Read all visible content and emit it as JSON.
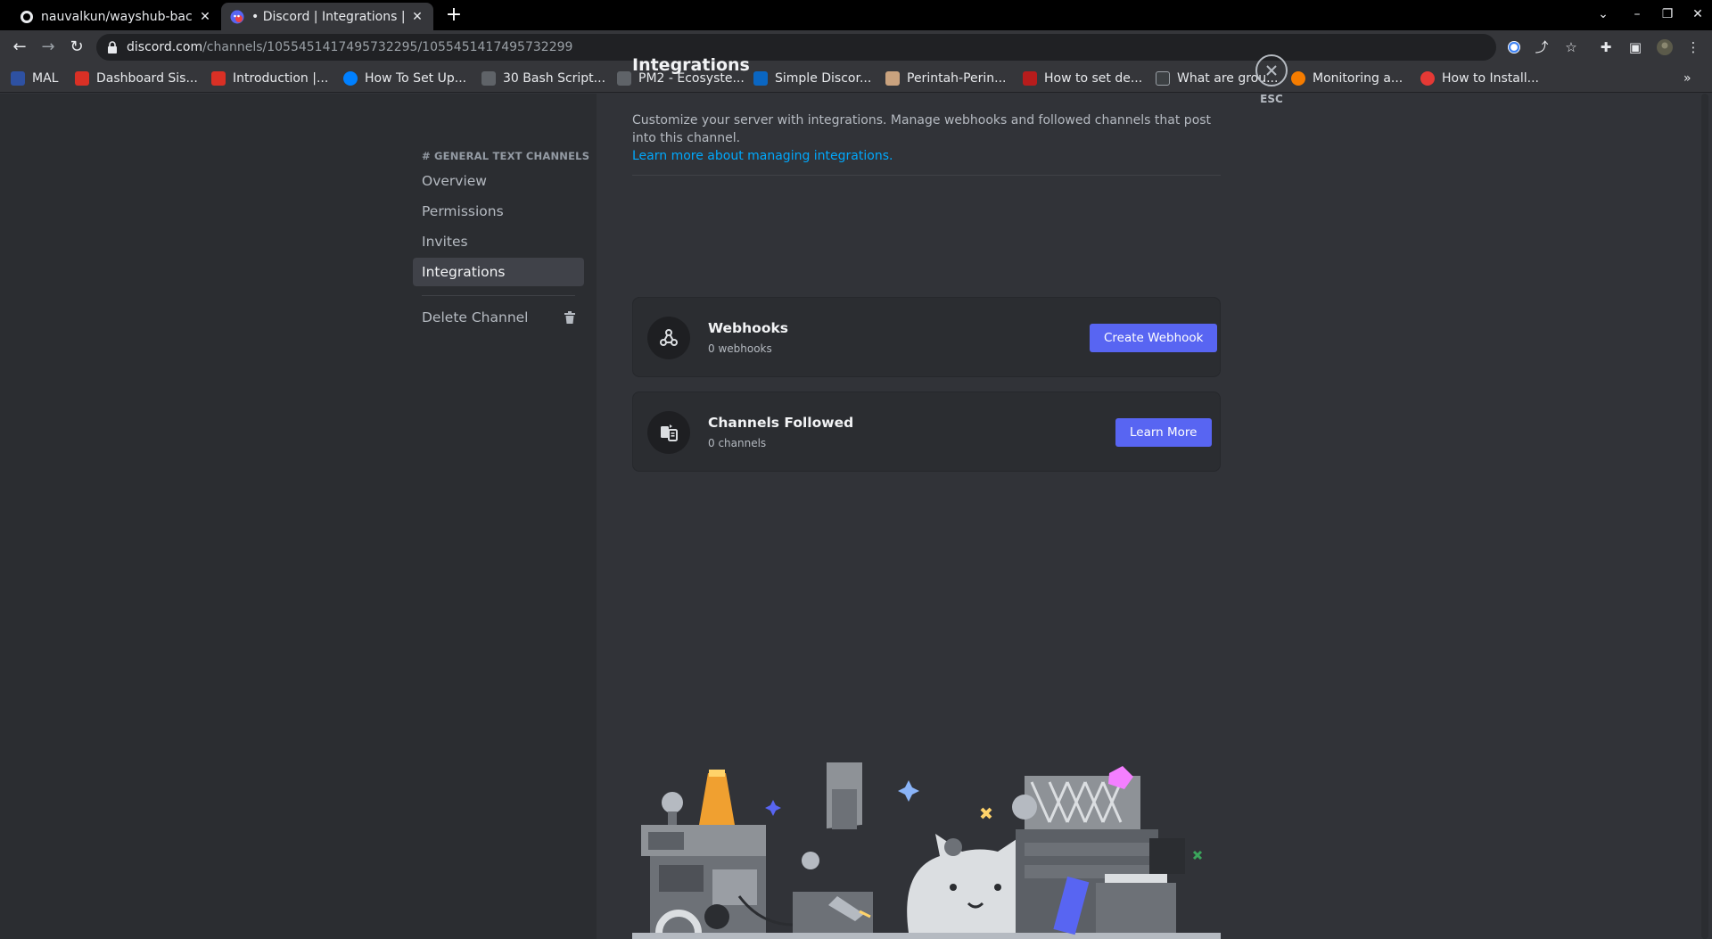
{
  "browser": {
    "tabs": [
      {
        "title": "nauvalkun/wayshub-back",
        "active": false
      },
      {
        "title": "• Discord | Integrations | D",
        "active": true
      }
    ],
    "url_host": "discord.com",
    "url_path": "/channels/1055451417495732295/1055451417495732299",
    "bookmarks": [
      {
        "label": "MAL",
        "color": "#2e51a2"
      },
      {
        "label": "Dashboard Sis...",
        "color": "#d93025"
      },
      {
        "label": "Introduction |...",
        "color": "#d93025"
      },
      {
        "label": "How To Set Up...",
        "color": "#0080ff"
      },
      {
        "label": "30 Bash Script...",
        "color": "#5f6368"
      },
      {
        "label": "PM2 - Ecosyste...",
        "color": "#5f6368"
      },
      {
        "label": "Simple Discor...",
        "color": "#0a66c2"
      },
      {
        "label": "Perintah-Perin...",
        "color": "#c9a27e"
      },
      {
        "label": "How to set de...",
        "color": "#b71c1c"
      },
      {
        "label": "What are grou...",
        "color": "#3c4043"
      },
      {
        "label": "Monitoring a...",
        "color": "#f57c00"
      },
      {
        "label": "How to Install...",
        "color": "#e53935"
      }
    ]
  },
  "sidebar": {
    "header": "# GENERAL TEXT CHANNELS",
    "items": [
      {
        "label": "Overview"
      },
      {
        "label": "Permissions"
      },
      {
        "label": "Invites"
      },
      {
        "label": "Integrations"
      }
    ],
    "delete_label": "Delete Channel"
  },
  "main": {
    "title": "Integrations",
    "description": "Customize your server with integrations. Manage webhooks and followed channels that post into this channel.",
    "learn_more_link": "Learn more about managing integrations.",
    "cards": [
      {
        "title": "Webhooks",
        "subtitle": "0 webhooks",
        "button": "Create Webhook"
      },
      {
        "title": "Channels Followed",
        "subtitle": "0 channels",
        "button": "Learn More"
      }
    ],
    "close_label": "ESC"
  },
  "colors": {
    "accent": "#5865f2",
    "link": "#00a8fc"
  }
}
